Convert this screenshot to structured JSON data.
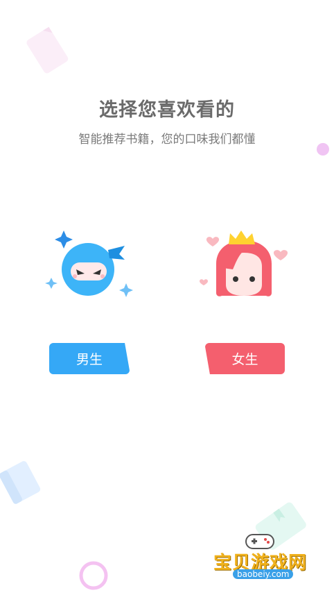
{
  "header": {
    "title": "选择您喜欢看的",
    "subtitle": "智能推荐书籍，您的口味我们都懂"
  },
  "options": {
    "male": {
      "label": "男生",
      "icon": "ninja-boy-icon",
      "color": "#35a8f6"
    },
    "female": {
      "label": "女生",
      "icon": "princess-girl-icon",
      "color": "#f45f6e"
    }
  },
  "watermark": {
    "text": "宝贝游戏网",
    "url": "baobeiy.com"
  }
}
